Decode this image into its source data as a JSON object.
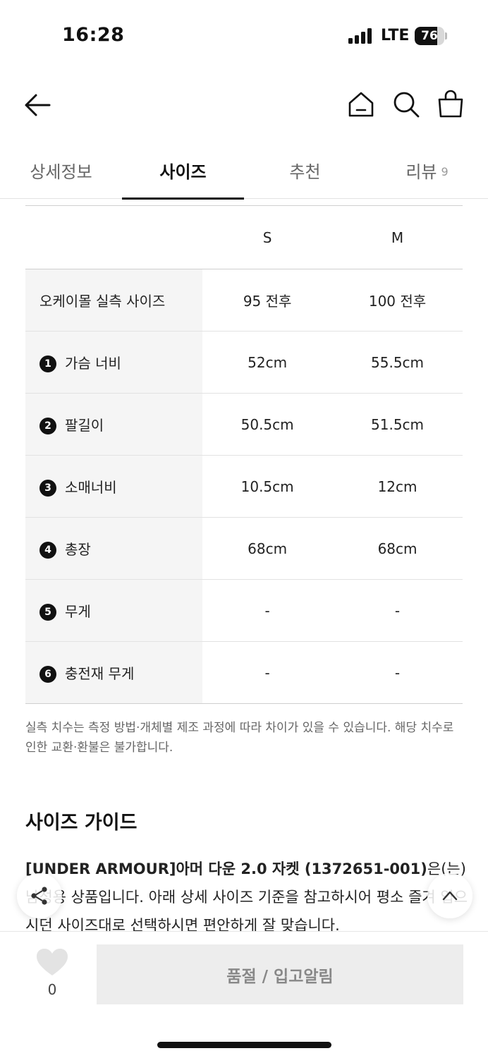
{
  "status_bar": {
    "time": "16:28",
    "network": "LTE",
    "battery": "76",
    "battery_level": 0.76
  },
  "nav": {
    "back": "back-arrow-icon",
    "home": "home-icon",
    "search": "search-icon",
    "cart": "shopping-bag-icon"
  },
  "tabs": [
    {
      "label": "상세정보"
    },
    {
      "label": "사이즈"
    },
    {
      "label": "추천"
    },
    {
      "label": "리뷰",
      "count": "9"
    }
  ],
  "size_table": {
    "columns": [
      "S",
      "M"
    ],
    "rows": [
      {
        "num": "",
        "label": "오케이몰 실측 사이즈",
        "s": "95 전후",
        "m": "100 전후"
      },
      {
        "num": "1",
        "label": "가슴 너비",
        "s": "52cm",
        "m": "55.5cm"
      },
      {
        "num": "2",
        "label": "팔길이",
        "s": "50.5cm",
        "m": "51.5cm"
      },
      {
        "num": "3",
        "label": "소매너비",
        "s": "10.5cm",
        "m": "12cm"
      },
      {
        "num": "4",
        "label": "총장",
        "s": "68cm",
        "m": "68cm"
      },
      {
        "num": "5",
        "label": "무게",
        "s": "-",
        "m": "-"
      },
      {
        "num": "6",
        "label": "충전재 무게",
        "s": "-",
        "m": "-"
      }
    ]
  },
  "disclaimer": "실측 치수는 측정 방법·개체별 제조 과정에 따라 차이가 있을 수 있습니다. 해당 치수로 인한 교환·환불은 불가합니다.",
  "guide": {
    "title": "사이즈 가이드",
    "product_name": "[UNDER ARMOUR]아머 다운 2.0 자켓 (1372651-001)",
    "body": "은(는) 남성용 상품입니다. 아래 상세 사이즈 기준을 참고하시어 평소 즐겨 입으시던 사이즈대로 선택하시면 편안하게 잘 맞습니다."
  },
  "floating": {
    "share": "share-icon",
    "top": "scroll-top-icon"
  },
  "bottom_bar": {
    "like_count": "0",
    "soldout_label": "품절 / 입고알림"
  }
}
